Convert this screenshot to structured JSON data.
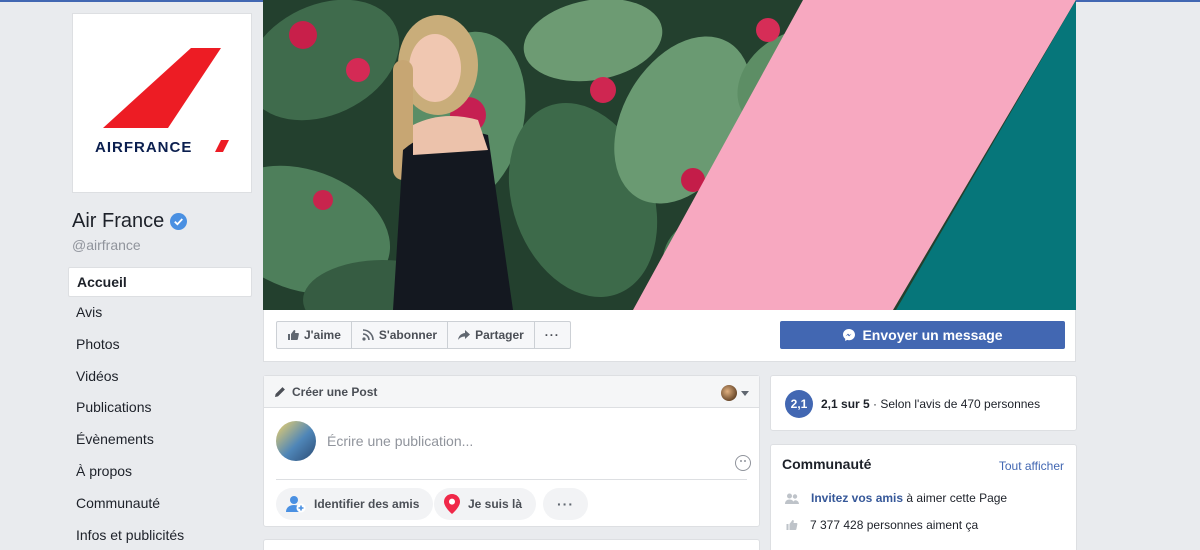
{
  "page": {
    "name": "Air France",
    "handle": "@airfrance",
    "logo_text": "AIRFRANCE"
  },
  "nav": {
    "items": [
      {
        "label": "Accueil"
      },
      {
        "label": "Avis"
      },
      {
        "label": "Photos"
      },
      {
        "label": "Vidéos"
      },
      {
        "label": "Publications"
      },
      {
        "label": "Évènements"
      },
      {
        "label": "À propos"
      },
      {
        "label": "Communauté"
      },
      {
        "label": "Infos et publicités"
      }
    ]
  },
  "actions": {
    "like": "J'aime",
    "follow": "S'abonner",
    "share": "Partager",
    "more": "···",
    "message": "Envoyer un message"
  },
  "composer": {
    "title": "Créer une Post",
    "placeholder": "Écrire une publication...",
    "tag_friends": "Identifier des amis",
    "checkin": "Je suis là",
    "more": "···"
  },
  "rating": {
    "score": "2,1",
    "score_text": "2,1 sur 5",
    "detail": " · Selon l'avis de 470 personnes"
  },
  "community": {
    "title": "Communauté",
    "see_all": "Tout afficher",
    "invite_link": "Invitez vos amis",
    "invite_rest": " à aimer cette Page",
    "likes": "7 377 428 personnes aiment ça"
  },
  "colors": {
    "brand_blue": "#4267b2",
    "airfrance_red": "#ed1c24",
    "airfrance_navy": "#0b1f4f",
    "cover_pink": "#f7a8c0",
    "cover_teal": "#06767a"
  }
}
